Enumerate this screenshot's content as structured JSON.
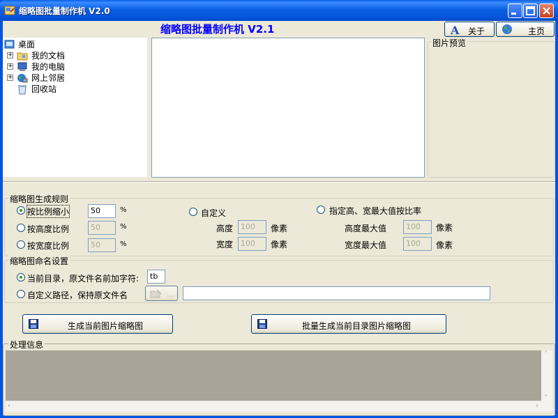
{
  "window": {
    "title": "缩略图批量制作机 V2.0"
  },
  "heading": "缩略图批量制作机 V2.1",
  "toolbar": {
    "about_label": "关于",
    "home_label": "主页"
  },
  "tree": {
    "root": "桌面",
    "items": [
      "我的文档",
      "我的电脑",
      "网上邻居",
      "回收站"
    ]
  },
  "preview": {
    "title": "图片预览"
  },
  "rules": {
    "title": "缩略图生成规则",
    "scale_label": "按比例缩小",
    "scale_value": "50",
    "height_ratio_label": "按高度比例",
    "height_ratio_value": "50",
    "width_ratio_label": "按宽度比例",
    "width_ratio_value": "50",
    "percent": "%",
    "custom_label": "自定义",
    "custom_height_label": "高度",
    "custom_height_value": "100",
    "custom_width_label": "宽度",
    "custom_width_value": "100",
    "pixel_unit": "像素",
    "max_label": "指定高、宽最大值按比率",
    "max_height_label": "高度最大值",
    "max_height_value": "100",
    "max_width_label": "宽度最大值",
    "max_width_value": "100"
  },
  "naming": {
    "title": "缩略图命名设置",
    "current_dir_label": "当前目录，原文件名前加字符:",
    "prefix_value": "tb",
    "custom_path_label": "自定义路径，保持原文件名",
    "path_value": ""
  },
  "actions": {
    "generate_current": "生成当前图片缩略图",
    "batch_generate": "批量生成当前目录图片缩略图"
  },
  "log": {
    "title": "处理信息"
  },
  "colors": {
    "title_bar": "#0054E3",
    "heading": "#0000FF",
    "face": "#ECE9D8",
    "log_bg": "#A8A598"
  }
}
